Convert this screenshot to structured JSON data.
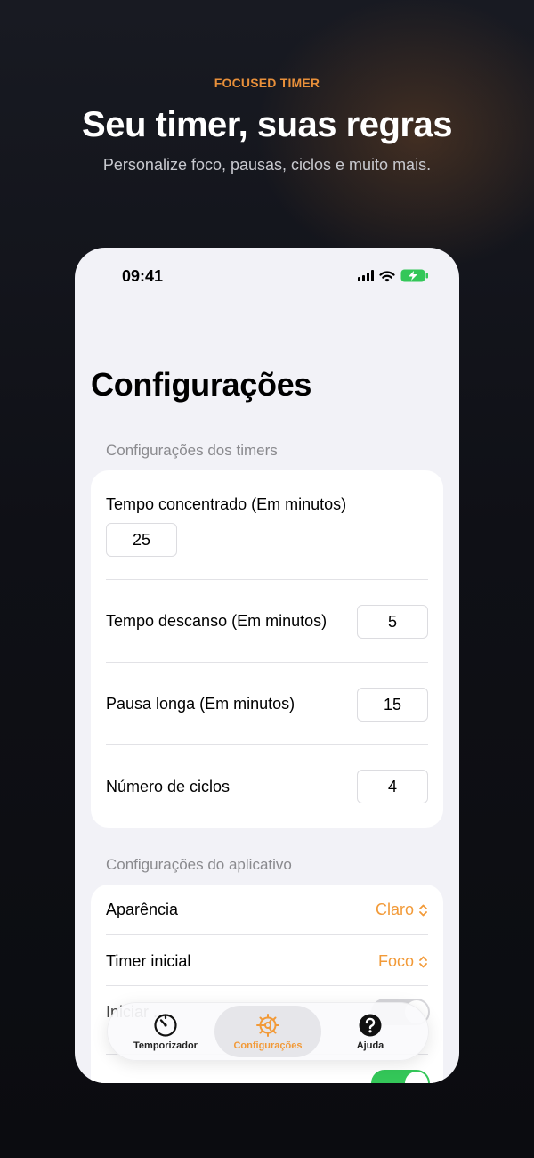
{
  "promo": {
    "eyebrow": "FOCUSED TIMER",
    "headline": "Seu timer, suas regras",
    "subhead": "Personalize foco, pausas, ciclos e muito mais."
  },
  "status_bar": {
    "time": "09:41"
  },
  "page_title": "Configurações",
  "timer_section": {
    "header": "Configurações dos timers",
    "rows": [
      {
        "label": "Tempo concentrado (Em minutos)",
        "value": "25"
      },
      {
        "label": "Tempo descanso (Em minutos)",
        "value": "5"
      },
      {
        "label": "Pausa longa (Em minutos)",
        "value": "15"
      },
      {
        "label": "Número de ciclos",
        "value": "4"
      }
    ]
  },
  "app_section": {
    "header": "Configurações do aplicativo",
    "appearance": {
      "label": "Aparência",
      "value": "Claro"
    },
    "initial_timer": {
      "label": "Timer inicial",
      "value": "Foco"
    },
    "toggle_rows": [
      {
        "label": "Iniciar ...",
        "on": false
      },
      {
        "label": "",
        "on": true
      }
    ]
  },
  "tabs": [
    {
      "label": "Temporizador",
      "icon": "timer-icon",
      "selected": false
    },
    {
      "label": "Configurações",
      "icon": "gear-icon",
      "selected": true
    },
    {
      "label": "Ajuda",
      "icon": "help-icon",
      "selected": false
    }
  ],
  "colors": {
    "accent": "#f29a38",
    "toggle_on": "#34c759",
    "battery": "#34c759"
  }
}
